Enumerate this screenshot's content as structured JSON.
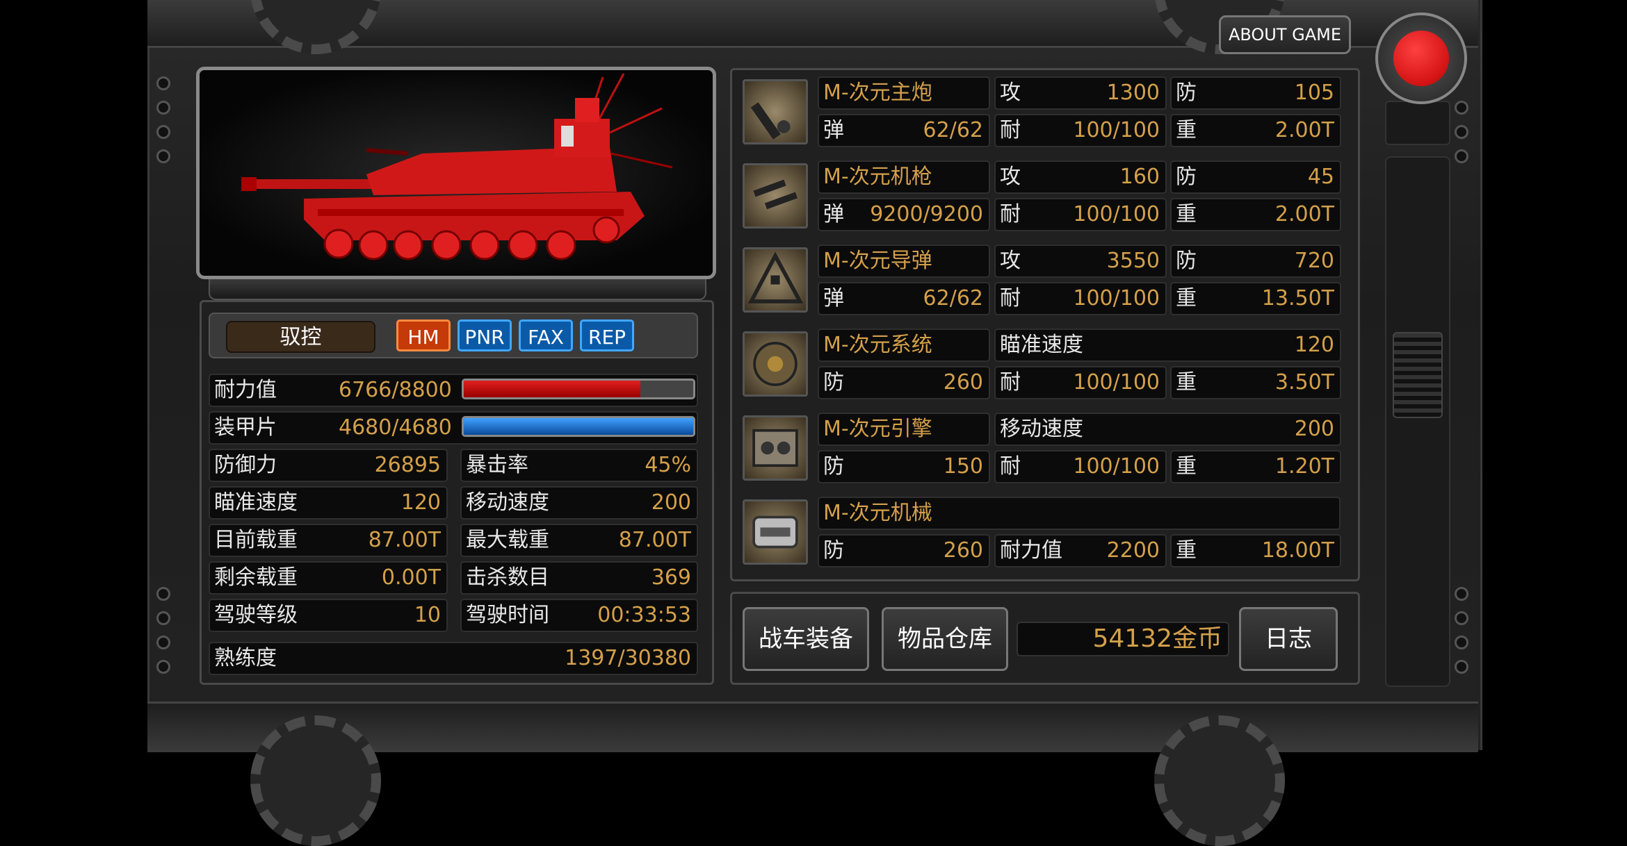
{
  "header": {
    "about_label": "ABOUT GAME"
  },
  "colors": {
    "accent_gold": "#d4a04a",
    "hp_red": "#c81414",
    "armor_blue": "#1e74c8",
    "record_red": "#e01010"
  },
  "control": {
    "drive_label": "驭控",
    "tags": [
      "HM",
      "PNR",
      "FAX",
      "REP"
    ]
  },
  "bars": [
    {
      "label": "耐力值",
      "value": "6766/8800",
      "fill": 0.77
    },
    {
      "label": "装甲片",
      "value": "4680/4680",
      "fill": 1.0
    }
  ],
  "stats": [
    {
      "label": "防御力",
      "value": "26895"
    },
    {
      "label": "暴击率",
      "value": "45%"
    },
    {
      "label": "瞄准速度",
      "value": "120"
    },
    {
      "label": "移动速度",
      "value": "200"
    },
    {
      "label": "目前载重",
      "value": "87.00T"
    },
    {
      "label": "最大载重",
      "value": "87.00T"
    },
    {
      "label": "剩余载重",
      "value": "0.00T"
    },
    {
      "label": "击杀数目",
      "value": "369"
    },
    {
      "label": "驾驶等级",
      "value": "10"
    },
    {
      "label": "驾驶时间",
      "value": "00:33:53"
    }
  ],
  "proficiency": {
    "label": "熟练度",
    "value": "1397/30380"
  },
  "equipment": [
    {
      "name": "M-次元主炮",
      "icon": "cannon-icon",
      "r1": [
        {
          "l": "攻",
          "v": "1300"
        },
        {
          "l": "防",
          "v": "105"
        }
      ],
      "r2": [
        {
          "l": "弹",
          "v": "62/62"
        },
        {
          "l": "耐",
          "v": "100/100"
        },
        {
          "l": "重",
          "v": "2.00T"
        }
      ]
    },
    {
      "name": "M-次元机枪",
      "icon": "machine-gun-icon",
      "r1": [
        {
          "l": "攻",
          "v": "160"
        },
        {
          "l": "防",
          "v": "45"
        }
      ],
      "r2": [
        {
          "l": "弹",
          "v": "9200/9200"
        },
        {
          "l": "耐",
          "v": "100/100"
        },
        {
          "l": "重",
          "v": "2.00T"
        }
      ]
    },
    {
      "name": "M-次元导弹",
      "icon": "missile-launcher-icon",
      "r1": [
        {
          "l": "攻",
          "v": "3550"
        },
        {
          "l": "防",
          "v": "720"
        }
      ],
      "r2": [
        {
          "l": "弹",
          "v": "62/62"
        },
        {
          "l": "耐",
          "v": "100/100"
        },
        {
          "l": "重",
          "v": "13.50T"
        }
      ]
    },
    {
      "name": "M-次元系统",
      "icon": "system-core-icon",
      "r1": [
        {
          "l": "瞄准速度",
          "v": "120"
        }
      ],
      "r2": [
        {
          "l": "防",
          "v": "260"
        },
        {
          "l": "耐",
          "v": "100/100"
        },
        {
          "l": "重",
          "v": "3.50T"
        }
      ]
    },
    {
      "name": "M-次元引擎",
      "icon": "engine-icon",
      "r1": [
        {
          "l": "移动速度",
          "v": "200"
        }
      ],
      "r2": [
        {
          "l": "防",
          "v": "150"
        },
        {
          "l": "耐",
          "v": "100/100"
        },
        {
          "l": "重",
          "v": "1.20T"
        }
      ]
    },
    {
      "name": "M-次元机械",
      "icon": "chassis-icon",
      "r1": [],
      "r2": [
        {
          "l": "防",
          "v": "260"
        },
        {
          "l": "耐力值",
          "v": "2200"
        },
        {
          "l": "重",
          "v": "18.00T"
        }
      ]
    }
  ],
  "footer": {
    "equip_label": "战车装备",
    "storage_label": "物品仓库",
    "gold": "54132金币",
    "log_label": "日志"
  }
}
